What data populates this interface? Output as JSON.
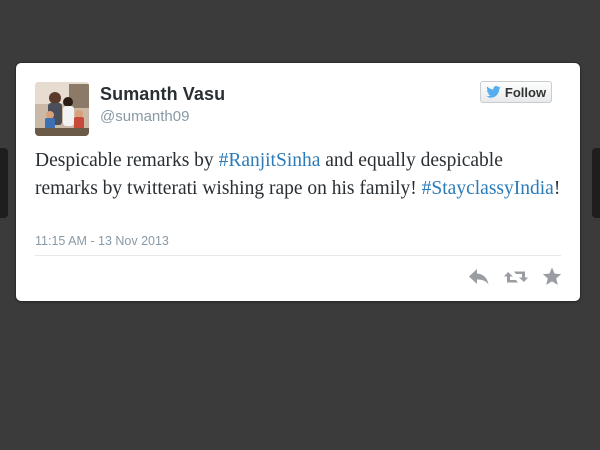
{
  "tweet": {
    "author": {
      "display_name": "Sumanth Vasu",
      "handle": "@sumanth09"
    },
    "follow_button_label": "Follow",
    "text_segments": [
      {
        "text": "Despicable remarks by ",
        "kind": "text"
      },
      {
        "text": "#RanjitSinha",
        "kind": "hashtag"
      },
      {
        "text": " and equally despicable remarks by twitterati wishing rape on his family! ",
        "kind": "text"
      },
      {
        "text": "#StayclassyIndia",
        "kind": "hashtag"
      },
      {
        "text": "!",
        "kind": "text"
      }
    ],
    "timestamp": "11:15 AM - 13 Nov 2013",
    "actions": [
      {
        "name": "reply",
        "icon": "reply-icon"
      },
      {
        "name": "retweet",
        "icon": "retweet-icon"
      },
      {
        "name": "favorite",
        "icon": "star-icon"
      }
    ]
  },
  "colors": {
    "background": "#3b3b3b",
    "card": "#ffffff",
    "hashtag": "#2b7bb9",
    "muted": "#8899a6",
    "twitter_blue": "#55acee"
  }
}
